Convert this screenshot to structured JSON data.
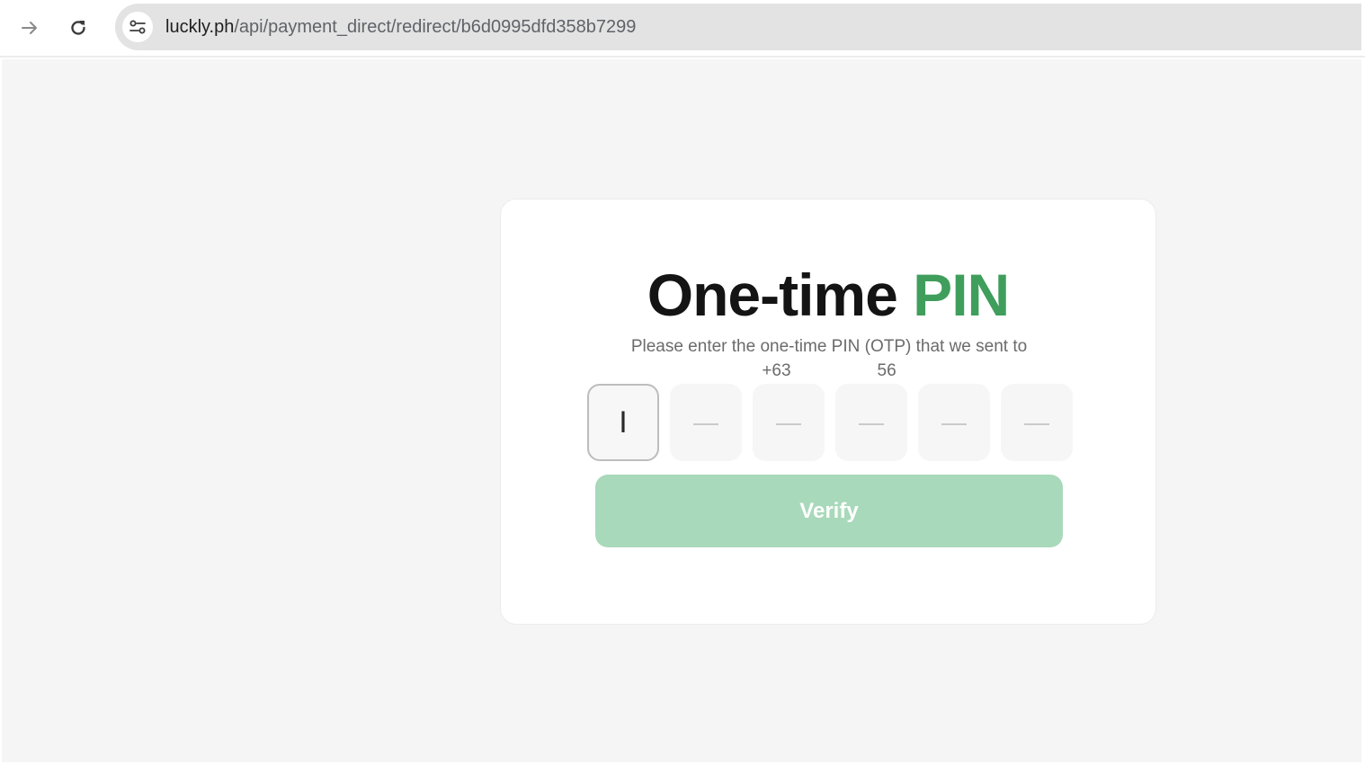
{
  "browser": {
    "forward_icon": "arrow-right-icon",
    "reload_icon": "reload-icon",
    "site_info_icon": "tune-icon",
    "url_host": "luckly.ph",
    "url_path": "/api/payment_direct/redirect/b6d0995dfd358b7299"
  },
  "page": {
    "title_main": "One-time ",
    "title_accent": "PIN",
    "subtitle": "Please enter the one-time PIN (OTP) that we sent to",
    "phone_prefix": "+63",
    "phone_suffix": "56",
    "otp": {
      "digits": [
        "I",
        "—",
        "—",
        "—",
        "—",
        "—"
      ]
    },
    "verify_label": "Verify"
  },
  "colors": {
    "accent": "#3f9e5c",
    "button_disabled": "#a8d9ba",
    "page_bg": "#f5f5f5"
  }
}
